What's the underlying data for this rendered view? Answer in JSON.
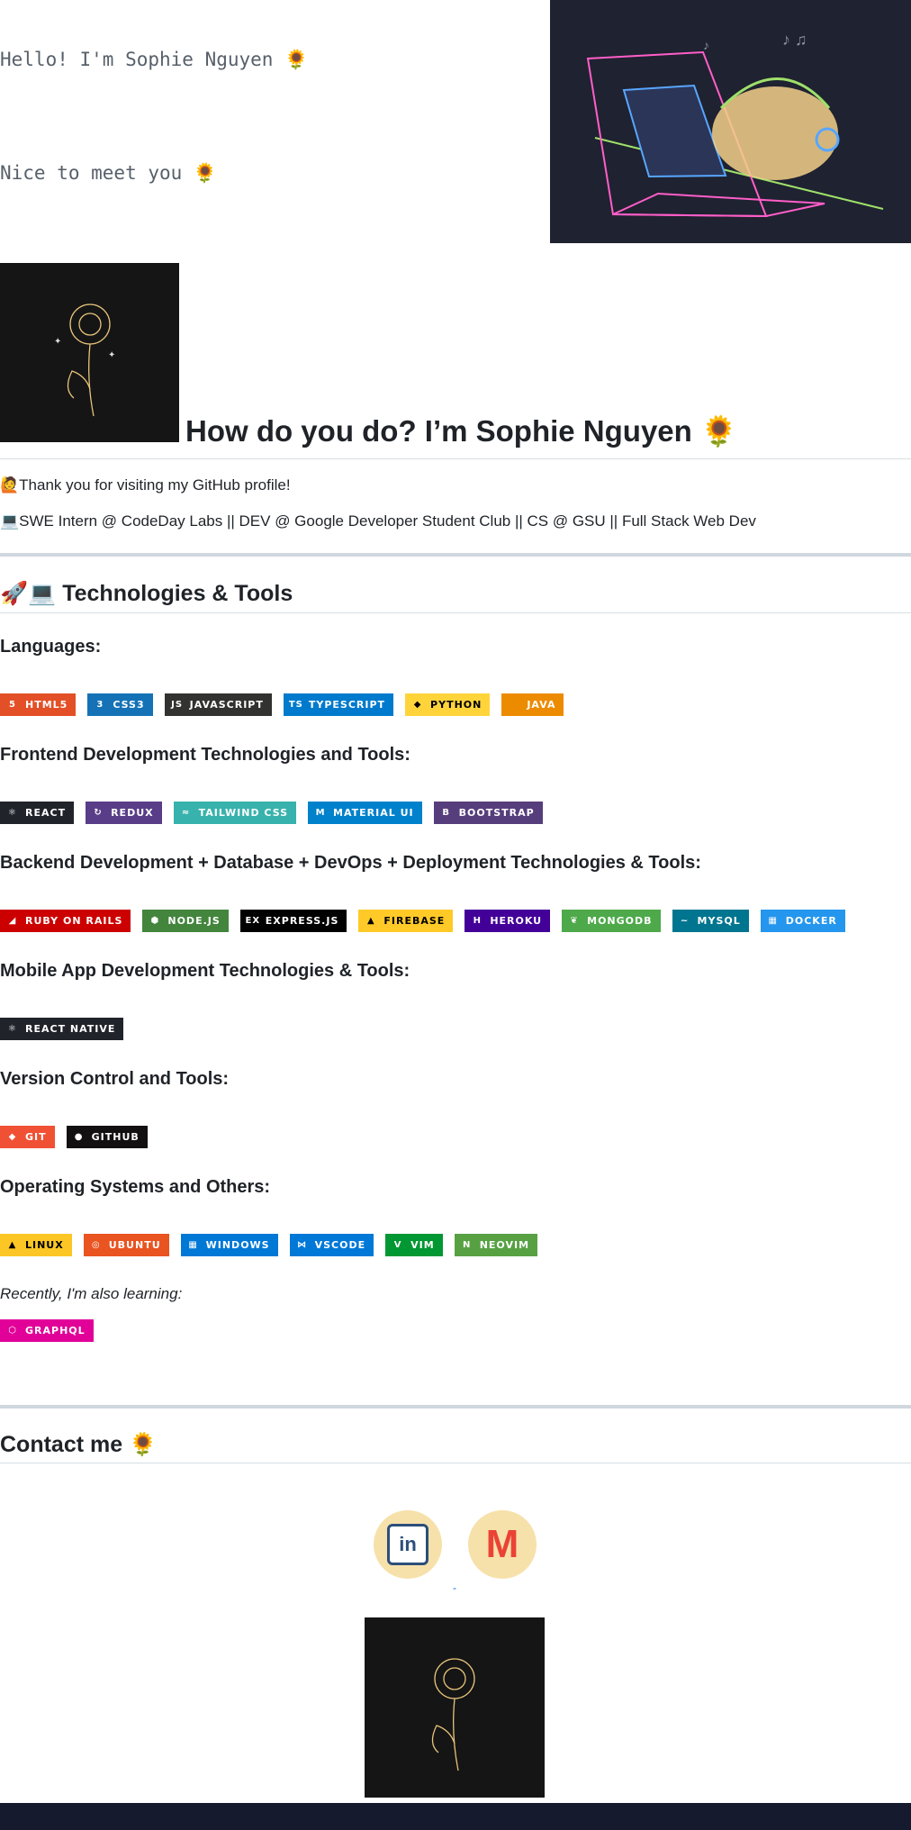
{
  "hero": {
    "greeting": "Hello! I'm Sophie Nguyen 🌻",
    "subtitle": "Nice to meet you 🌻"
  },
  "intro": {
    "heading": "How do you do? I’m Sophie Nguyen 🌻",
    "line1": "🙋Thank you for visiting my GitHub profile!",
    "line2": "💻SWE Intern @ CodeDay Labs || DEV @ Google Developer Student Club || CS @ GSU || Full Stack Web Dev"
  },
  "tech": {
    "heading": "🚀💻 Technologies & Tools",
    "sections": [
      {
        "title": "Languages:",
        "badges": [
          {
            "label": "HTML5",
            "color": "#e34f26",
            "icon": "html5-icon",
            "glyph": "5"
          },
          {
            "label": "CSS3",
            "color": "#1572b6",
            "icon": "css3-icon",
            "glyph": "3"
          },
          {
            "label": "JAVASCRIPT",
            "color": "#323330",
            "icon": "javascript-icon",
            "glyph": "JS"
          },
          {
            "label": "TYPESCRIPT",
            "color": "#007acc",
            "icon": "typescript-icon",
            "glyph": "TS"
          },
          {
            "label": "PYTHON",
            "color": "#ffd43b",
            "icon": "python-icon",
            "glyph": "◆"
          },
          {
            "label": "JAVA",
            "color": "#ed8b00",
            "icon": "java-icon",
            "glyph": ""
          }
        ]
      },
      {
        "title": "Frontend Development Technologies and Tools:",
        "badges": [
          {
            "label": "REACT",
            "color": "#20232a",
            "icon": "react-icon",
            "glyph": "⚛"
          },
          {
            "label": "REDUX",
            "color": "#593d88",
            "icon": "redux-icon",
            "glyph": "↻"
          },
          {
            "label": "TAILWIND CSS",
            "color": "#38b2ac",
            "icon": "tailwind-icon",
            "glyph": "≈"
          },
          {
            "label": "MATERIAL UI",
            "color": "#0081cb",
            "icon": "material-ui-icon",
            "glyph": "M"
          },
          {
            "label": "BOOTSTRAP",
            "color": "#563d7c",
            "icon": "bootstrap-icon",
            "glyph": "B"
          }
        ]
      },
      {
        "title": "Backend Development + Database + DevOps + Deployment Technologies & Tools:",
        "badges": [
          {
            "label": "RUBY ON RAILS",
            "color": "#cc0000",
            "icon": "rails-icon",
            "glyph": "◢"
          },
          {
            "label": "NODE.JS",
            "color": "#43853d",
            "icon": "nodejs-icon",
            "glyph": "⬢"
          },
          {
            "label": "EXPRESS.JS",
            "color": "#000000",
            "icon": "express-icon",
            "glyph": "ex"
          },
          {
            "label": "FIREBASE",
            "color": "#ffca28",
            "icon": "firebase-icon",
            "glyph": "▲"
          },
          {
            "label": "HEROKU",
            "color": "#430098",
            "icon": "heroku-icon",
            "glyph": "H"
          },
          {
            "label": "MONGODB",
            "color": "#4ea94b",
            "icon": "mongodb-icon",
            "glyph": "❦"
          },
          {
            "label": "MYSQL",
            "color": "#00758f",
            "icon": "mysql-icon",
            "glyph": "~"
          },
          {
            "label": "DOCKER",
            "color": "#2496ed",
            "icon": "docker-icon",
            "glyph": "▦"
          }
        ]
      },
      {
        "title": "Mobile App Development Technologies & Tools:",
        "badges": [
          {
            "label": "REACT NATIVE",
            "color": "#20232a",
            "icon": "react-native-icon",
            "glyph": "⚛"
          }
        ]
      },
      {
        "title": "Version Control and Tools:",
        "badges": [
          {
            "label": "GIT",
            "color": "#f05033",
            "icon": "git-icon",
            "glyph": "◆"
          },
          {
            "label": "GITHUB",
            "color": "#121011",
            "icon": "github-icon",
            "glyph": "●"
          }
        ]
      },
      {
        "title": "Operating Systems and Others:",
        "badges": [
          {
            "label": "LINUX",
            "color": "#fcc624",
            "icon": "linux-icon",
            "glyph": "▲"
          },
          {
            "label": "UBUNTU",
            "color": "#e95420",
            "icon": "ubuntu-icon",
            "glyph": "◎"
          },
          {
            "label": "WINDOWS",
            "color": "#0078d6",
            "icon": "windows-icon",
            "glyph": "▦"
          },
          {
            "label": "VSCODE",
            "color": "#0078d7",
            "icon": "vscode-icon",
            "glyph": "⋈"
          },
          {
            "label": "VIM",
            "color": "#019733",
            "icon": "vim-icon",
            "glyph": "V"
          },
          {
            "label": "NEOVIM",
            "color": "#57a143",
            "icon": "neovim-icon",
            "glyph": "N"
          }
        ]
      }
    ],
    "learning_label": "Recently, I'm also learning:",
    "learning_badges": [
      {
        "label": "GRAPHQL",
        "color": "#e10098",
        "icon": "graphql-icon",
        "glyph": "⬡"
      }
    ]
  },
  "contact": {
    "heading": "Contact me 🌻",
    "separator": "-",
    "links": [
      {
        "name": "linkedin",
        "glyph": "in",
        "icon": "linkedin-icon"
      },
      {
        "name": "gmail",
        "glyph": "M",
        "icon": "gmail-icon"
      }
    ]
  }
}
